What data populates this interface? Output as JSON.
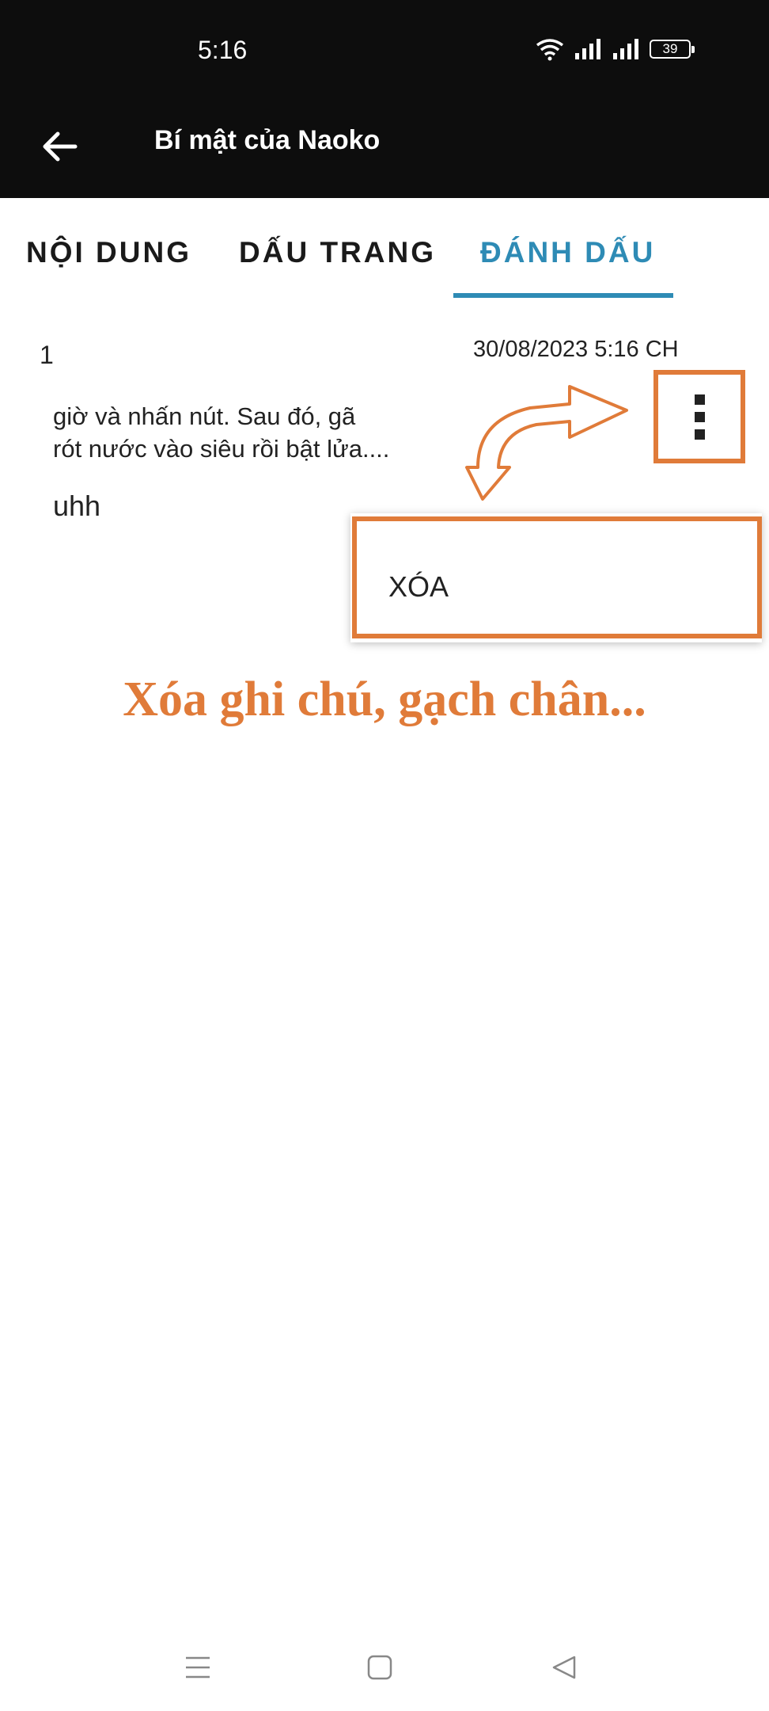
{
  "status_bar": {
    "time": "5:16",
    "battery": "39"
  },
  "app_bar": {
    "title": "Bí mật của Naoko"
  },
  "tabs": [
    {
      "label": "NỘI DUNG",
      "active": false
    },
    {
      "label": "DẤU TRANG",
      "active": false
    },
    {
      "label": "ĐÁNH DẤU",
      "active": true
    }
  ],
  "bookmark": {
    "number": "1",
    "date": "30/08/2023 5:16 CH",
    "excerpt_line1": "giờ và nhấn nút. Sau đó, gã",
    "excerpt_line2": "rót nước vào siêu rồi bật lửa....",
    "note": "uhh"
  },
  "popup_menu": {
    "items": [
      "XÓA"
    ]
  },
  "annotation": {
    "text": "Xóa ghi chú, gạch chân..."
  },
  "colors": {
    "accent": "#2e8bb5",
    "annotation": "#e07b39",
    "app_bar": "#0d0d0d"
  },
  "icons": {
    "back": "arrow-left-icon",
    "more": "more-vertical-icon",
    "nav_recent": "menu-lines-icon",
    "nav_home": "square-icon",
    "nav_back": "triangle-back-icon"
  }
}
